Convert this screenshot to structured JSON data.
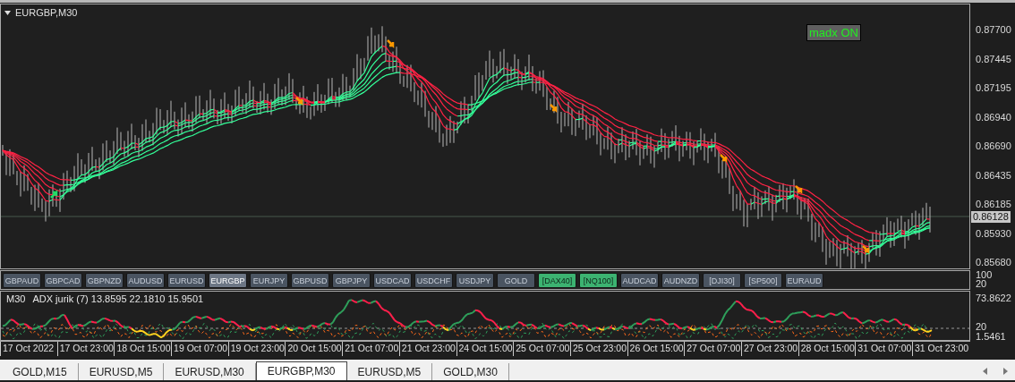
{
  "chart": {
    "title": "EURGBP,M30",
    "indicator_label": "madx ON",
    "price_axis": [
      "0.87700",
      "0.87445",
      "0.87195",
      "0.86940",
      "0.86690",
      "0.86435",
      "0.86185",
      "0.85930",
      "0.85680"
    ],
    "current_price": "0.86128"
  },
  "symbol_buttons": [
    {
      "label": "GBPAUD",
      "selected": false,
      "active": false
    },
    {
      "label": "GBPCAD",
      "selected": false,
      "active": false
    },
    {
      "label": "GBPNZD",
      "selected": false,
      "active": false
    },
    {
      "label": "AUDUSD",
      "selected": false,
      "active": false
    },
    {
      "label": "EURUSD",
      "selected": false,
      "active": false
    },
    {
      "label": "EURGBP",
      "selected": true,
      "active": false
    },
    {
      "label": "EURJPY",
      "selected": false,
      "active": false
    },
    {
      "label": "GBPUSD",
      "selected": false,
      "active": false
    },
    {
      "label": "GBPJPY",
      "selected": false,
      "active": false
    },
    {
      "label": "USDCAD",
      "selected": false,
      "active": false
    },
    {
      "label": "USDCHF",
      "selected": false,
      "active": false
    },
    {
      "label": "USDJPY",
      "selected": false,
      "active": false
    },
    {
      "label": "GOLD",
      "selected": false,
      "active": false
    },
    {
      "label": "[DAX40]",
      "selected": false,
      "active": true
    },
    {
      "label": "[NQ100]",
      "selected": false,
      "active": true
    },
    {
      "label": "AUDCAD",
      "selected": false,
      "active": false
    },
    {
      "label": "AUDNZD",
      "selected": false,
      "active": false
    },
    {
      "label": "[DJI30]",
      "selected": false,
      "active": false
    },
    {
      "label": "[SP500]",
      "selected": false,
      "active": false
    },
    {
      "label": "EURAUD",
      "selected": false,
      "active": false
    }
  ],
  "buttons_axis": [
    "100",
    "20"
  ],
  "indicator": {
    "timeframe": "M30",
    "legend": "ADX jurik (7) 13.8595 22.1810 15.9501",
    "axis": [
      "73.8622",
      "20",
      "1.5461"
    ]
  },
  "time_axis": [
    "17 Oct 2022",
    "17 Oct 23:00",
    "18 Oct 15:00",
    "19 Oct 07:00",
    "19 Oct 23:00",
    "20 Oct 15:00",
    "21 Oct 07:00",
    "21 Oct 23:00",
    "24 Oct 15:00",
    "25 Oct 07:00",
    "25 Oct 23:00",
    "26 Oct 15:00",
    "27 Oct 07:00",
    "27 Oct 23:00",
    "28 Oct 15:00",
    "31 Oct 07:00",
    "31 Oct 23:00"
  ],
  "tabs": [
    {
      "label": "GOLD,M15",
      "selected": false
    },
    {
      "label": "EURUSD,M5",
      "selected": false
    },
    {
      "label": "EURUSD,M30",
      "selected": false
    },
    {
      "label": "EURGBP,M30",
      "selected": true
    },
    {
      "label": "EURUSD,M5",
      "selected": false
    },
    {
      "label": "GOLD,M30",
      "selected": false
    }
  ]
}
